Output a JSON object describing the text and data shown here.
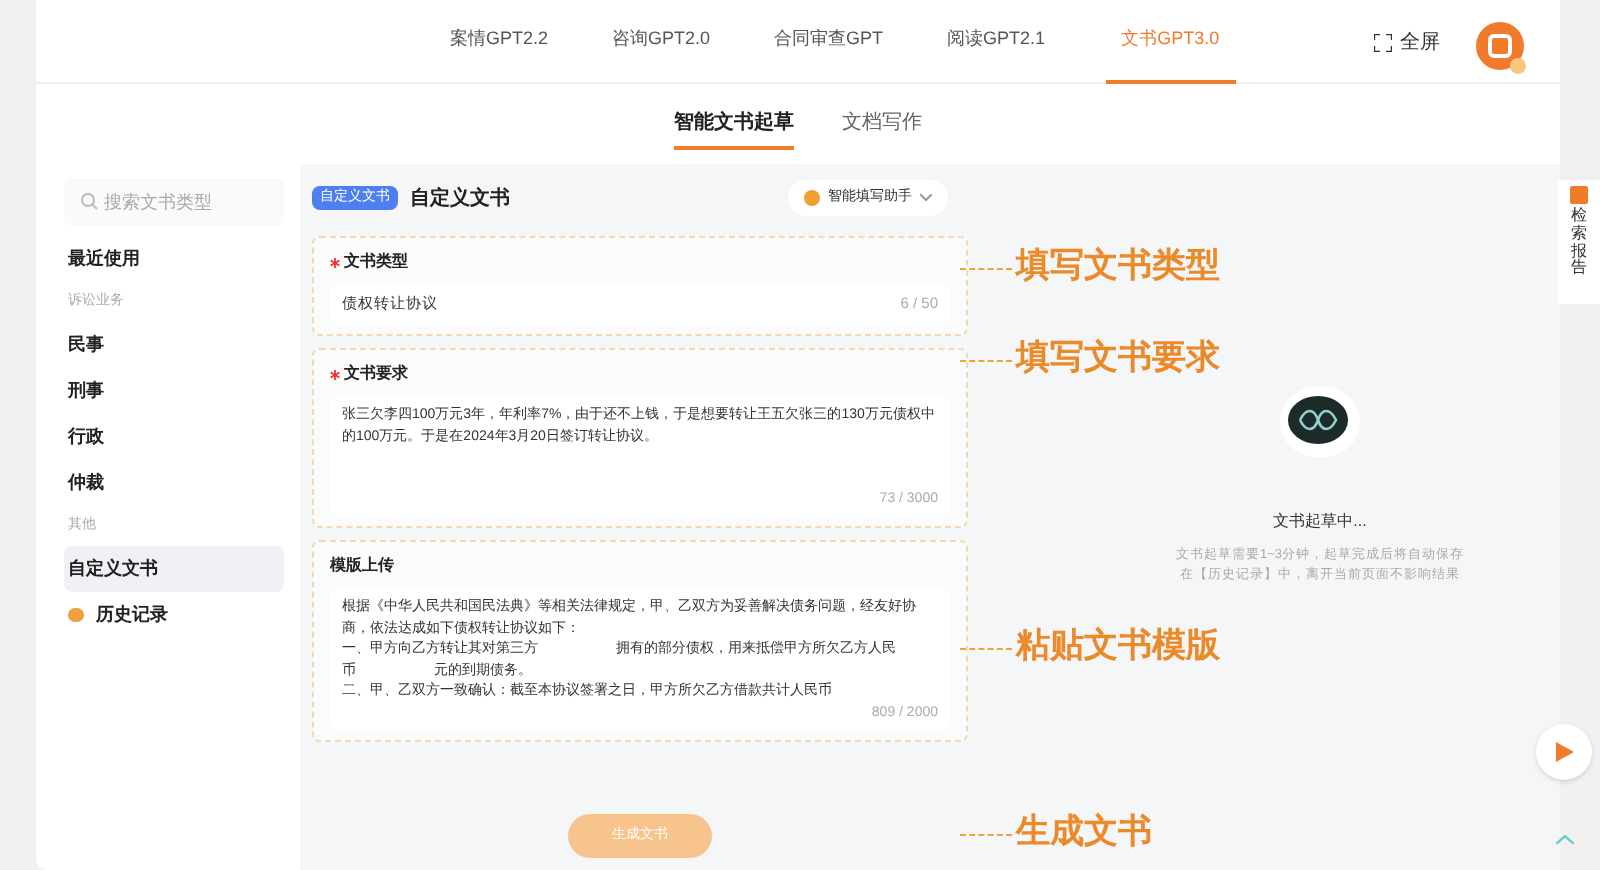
{
  "top_tabs": [
    {
      "label": "案情GPT2.2",
      "selected": false
    },
    {
      "label": "咨询GPT2.0",
      "selected": false
    },
    {
      "label": "合同审查GPT",
      "selected": false
    },
    {
      "label": "阅读GPT2.1",
      "selected": false
    },
    {
      "label": "文书GPT3.0",
      "selected": true
    }
  ],
  "fullscreen": {
    "label": "全屏"
  },
  "sub_tabs": [
    {
      "label": "智能文书起草",
      "selected": true
    },
    {
      "label": "文档写作",
      "selected": false
    }
  ],
  "sidebar": {
    "search": {
      "placeholder": "搜索文书类型"
    },
    "items": [
      {
        "kind": "item",
        "label": "最近使用",
        "selected": false
      },
      {
        "kind": "group",
        "label": "诉讼业务"
      },
      {
        "kind": "item",
        "label": "民事",
        "selected": false
      },
      {
        "kind": "item",
        "label": "刑事",
        "selected": false
      },
      {
        "kind": "item",
        "label": "行政",
        "selected": false
      },
      {
        "kind": "item",
        "label": "仲裁",
        "selected": false
      },
      {
        "kind": "group",
        "label": "其他"
      },
      {
        "kind": "item",
        "label": "自定义文书",
        "selected": true
      },
      {
        "kind": "history",
        "label": "历史记录"
      }
    ]
  },
  "form": {
    "tag": "自定义文书",
    "title": "自定义文书",
    "assistant": "智能填写助手",
    "fields": [
      {
        "label": "文书类型",
        "required": true,
        "value": [
          "债权转让协议"
        ],
        "count": "6 / 50",
        "kind": "input"
      },
      {
        "label": "文书要求",
        "required": true,
        "value": [
          "张三欠李四100万元3年，年利率7%，由于还不上钱，于是想要转让王五欠张三的130万元债权中的100万元。于是在2024年3月20日签订转让协议。"
        ],
        "count": "73 / 3000",
        "kind": "textarea"
      },
      {
        "label": "模版上传",
        "required": false,
        "value": [
          "根据《中华人民共和国民法典》等相关法律规定，甲、乙双方为妥善解决债务问题，经友好协商，依法达成如下债权转让协议如下：",
          "一、甲方向乙方转让其对第三方                    拥有的部分债权，用来抵偿甲方所欠乙方人民",
          "币                    元的到期债务。",
          "二、甲、乙双方一致确认：截至本协议签署之日，甲方所欠乙方借款共计人民币"
        ],
        "count": "809 / 2000",
        "kind": "template"
      }
    ],
    "submit": "生成文书"
  },
  "status": {
    "title": "文书起草中...",
    "note": "文书起草需要1~3分钟，起草完成后将自动保存在【历史记录】中，离开当前页面不影响结果"
  },
  "side_tab": {
    "label": "检索报告"
  },
  "callouts": [
    "填写文书类型",
    "填写文书要求",
    "粘贴文书模版",
    "生成文书"
  ]
}
